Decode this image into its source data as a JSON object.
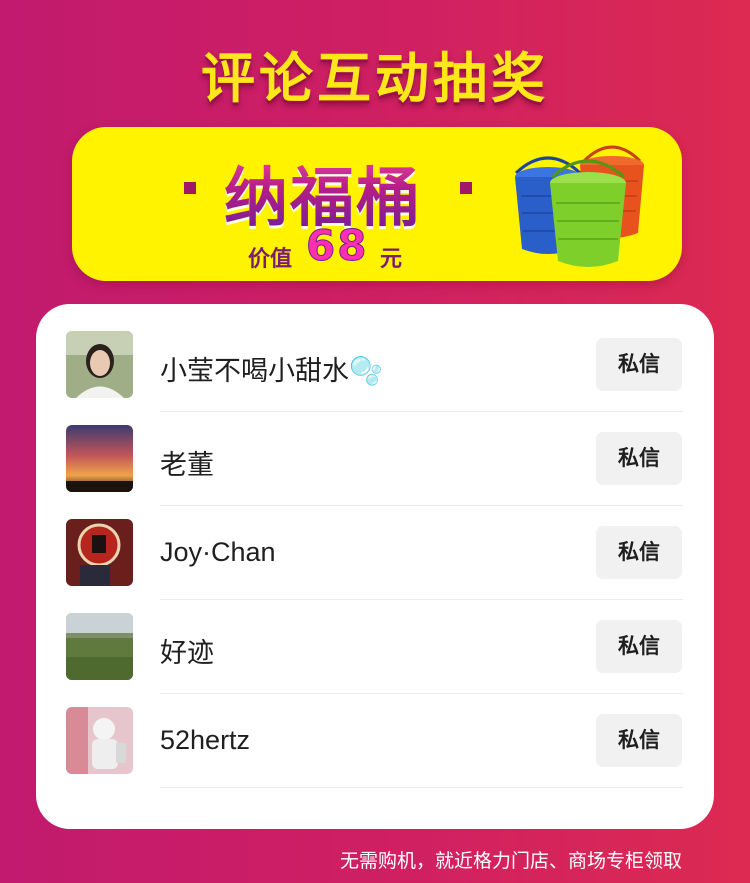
{
  "page": {
    "title": "评论互动抽奖"
  },
  "prize": {
    "name": "纳福桶",
    "price_label": "价值",
    "price_value": "68",
    "price_unit": "元",
    "bucket_colors": [
      "#2a5fc9",
      "#7fcf2a",
      "#e8521e"
    ]
  },
  "winners": [
    {
      "name": "小莹不喝小甜水🫧",
      "button": "私信"
    },
    {
      "name": "老董",
      "button": "私信"
    },
    {
      "name": "Joy·Chan",
      "button": "私信"
    },
    {
      "name": "好迹",
      "button": "私信"
    },
    {
      "name": "52hertz",
      "button": "私信"
    }
  ],
  "footer": {
    "text": "无需购机，就近格力门店、商场专柜领取"
  }
}
